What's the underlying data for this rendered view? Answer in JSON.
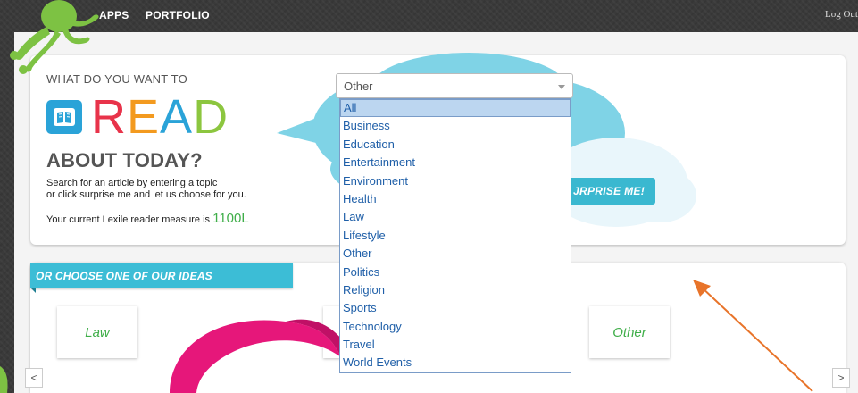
{
  "nav": {
    "apps_label": "APPS",
    "portfolio_label": "PORTFOLIO",
    "logout_label": "Log Out"
  },
  "hero": {
    "prompt_top": "WHAT DO YOU WANT TO",
    "read_word": [
      "R",
      "E",
      "A",
      "D"
    ],
    "read_colors": [
      "#e8334a",
      "#f39a1f",
      "#2aa3d8",
      "#8cc63f"
    ],
    "prompt_bottom": "ABOUT TODAY?",
    "desc_line1": "Search for an article by entering a topic",
    "desc_line2": "or click surprise me and let us choose for you.",
    "lexile_text": "Your current Lexile reader measure is",
    "lexile_value": "1100L"
  },
  "topic_select": {
    "value": "Other",
    "options": [
      "All",
      "Business",
      "Education",
      "Entertainment",
      "Environment",
      "Health",
      "Law",
      "Lifestyle",
      "Other",
      "Politics",
      "Religion",
      "Sports",
      "Technology",
      "Travel",
      "World Events"
    ],
    "highlighted": "All"
  },
  "surprise_button_label": "JRPRISE ME!",
  "ideas": {
    "banner": "OR CHOOSE ONE OF OUR IDEAS",
    "tiles": [
      "Law",
      "Other"
    ]
  },
  "carousel": {
    "prev": "<",
    "next": ">"
  },
  "colors": {
    "accent": "#3cbdd6",
    "green": "#3fae49",
    "annotation_arrow": "#e8742a"
  }
}
